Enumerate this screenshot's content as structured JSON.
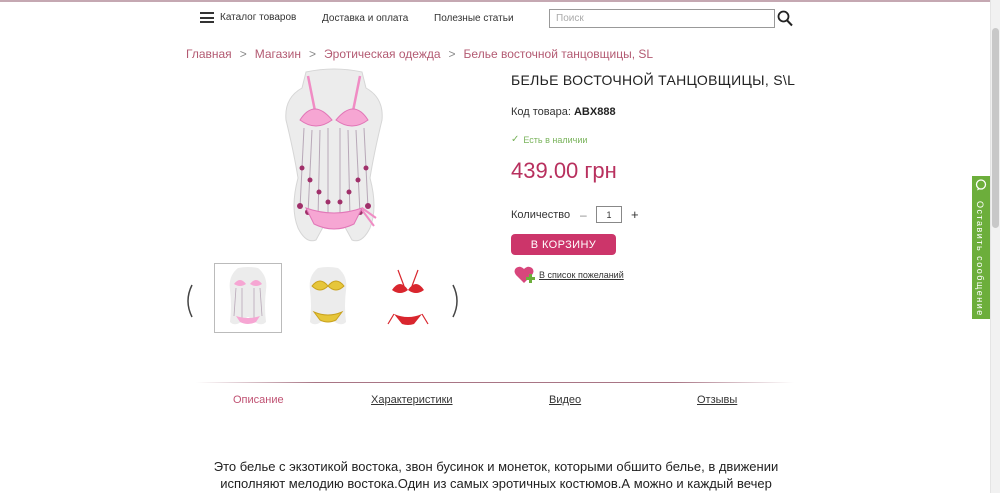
{
  "header": {
    "catalog_label": "Каталог товаров",
    "delivery_label": "Доставка и оплата",
    "articles_label": "Полезные статьи",
    "search_placeholder": "Поиск"
  },
  "breadcrumb": [
    {
      "label": "Главная"
    },
    {
      "label": "Магазин"
    },
    {
      "label": "Эротическая одежда"
    },
    {
      "label": "Белье восточной танцовщицы, SL"
    }
  ],
  "breadcrumb_separator": ">",
  "product": {
    "title": "БЕЛЬЕ ВОСТОЧНОЙ ТАНЦОВЩИЦЫ, S\\L",
    "sku_label": "Код товара:",
    "sku_value": "ABX888",
    "stock_status": "Есть в наличии",
    "price": "439.00 грн",
    "quantity_label": "Количество",
    "quantity_value": "1",
    "minus_label": "–",
    "plus_label": "+",
    "add_to_cart_label": "В КОРЗИНУ",
    "wishlist_label": "В список пожеланий"
  },
  "feedback_tab": {
    "label": "Оставить сообщение"
  },
  "tabs": {
    "description": "Описание",
    "characteristics": "Характеристики",
    "video": "Видео",
    "reviews": "Отзывы"
  },
  "description_text": "Это белье с экзотикой востока, звон бусинок и монеток, которыми обшито белье, в движении исполняют мелодию востока.Один из самых эротичных костюмов.А можно и каждый вечер",
  "colors": {
    "accent": "#cc356a",
    "price": "#b8305e",
    "link": "#b35a72",
    "in_stock": "#79b35b",
    "feedback_tab": "#6cae3b"
  }
}
